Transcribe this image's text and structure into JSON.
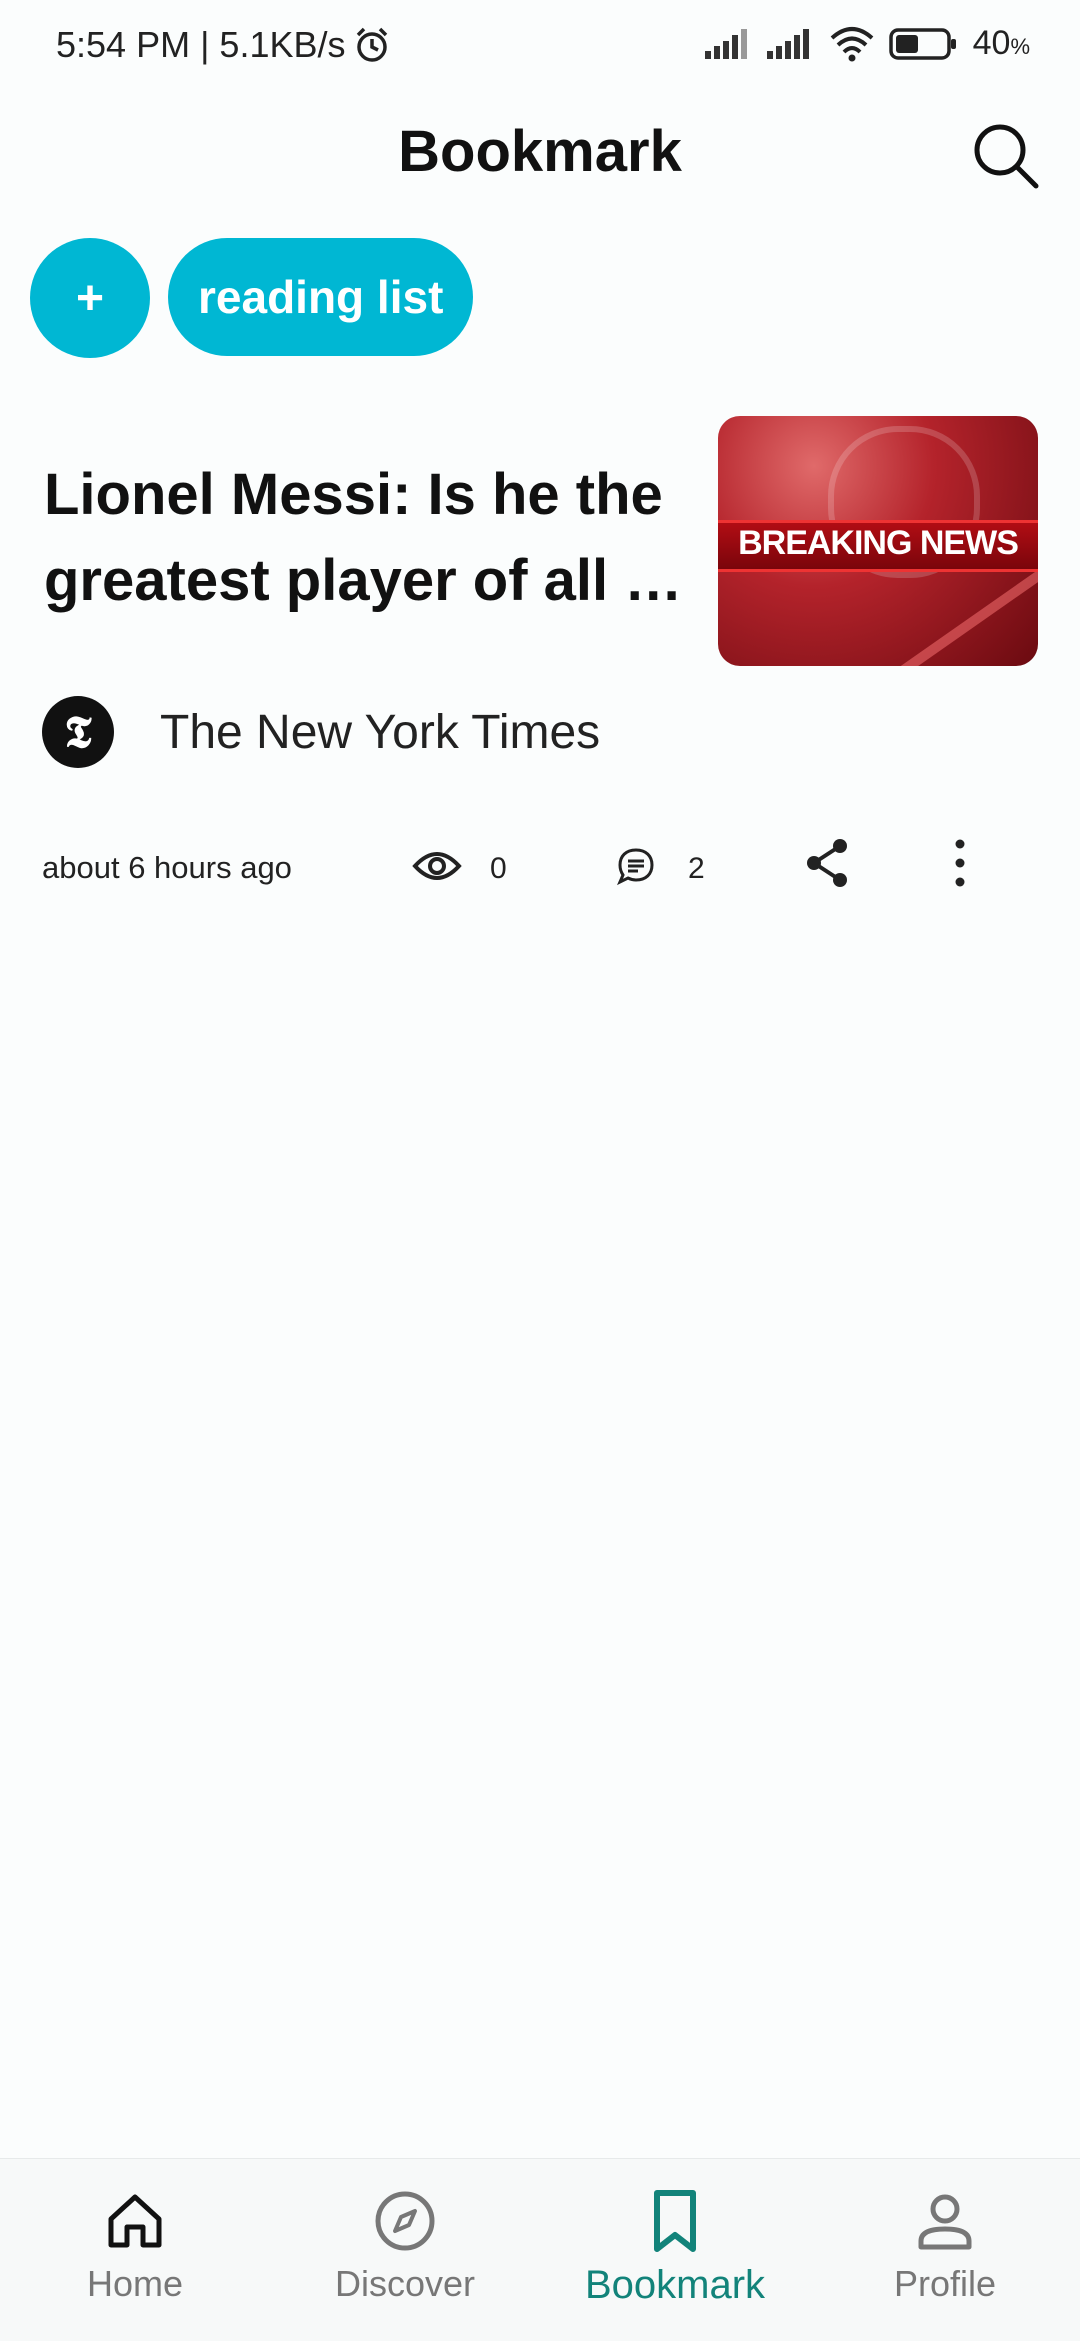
{
  "status_bar": {
    "time_speed": "5:54 PM | 5.1KB/s",
    "battery": "40",
    "battery_unit": "%"
  },
  "header": {
    "title": "Bookmark"
  },
  "chips": {
    "add_label": "+",
    "lists": [
      "reading list"
    ]
  },
  "article": {
    "title": "Lionel Messi: Is he the greatest player of all …",
    "thumbnail_text": "BREAKING NEWS",
    "source_name": "The New York Times",
    "source_logo": "𝕿",
    "time": "about 6 hours ago",
    "views": "0",
    "comments": "2"
  },
  "bottom_nav": {
    "items": [
      {
        "label": "Home",
        "icon": "home-icon"
      },
      {
        "label": "Discover",
        "icon": "compass-icon"
      },
      {
        "label": "Bookmark",
        "icon": "bookmark-icon",
        "active": true
      },
      {
        "label": "Profile",
        "icon": "person-icon"
      }
    ]
  },
  "colors": {
    "accent": "#00b7d3",
    "active_nav": "#12837a",
    "background": "#fbfdfd"
  }
}
